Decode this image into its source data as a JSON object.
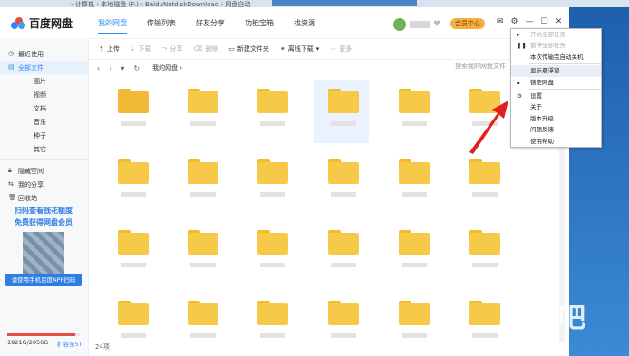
{
  "titlebar": {
    "app_name": "百度网盘",
    "tabs": [
      "我的网盘",
      "传输列表",
      "好友分享",
      "功能宝箱",
      "找资源"
    ],
    "vip_label": "会员中心"
  },
  "address": {
    "text": "› 计算机 › 本地磁盘 (F:) › BaiduNetdiskDownload › 网盘自动"
  },
  "sidebar": {
    "items": [
      {
        "label": "最近使用",
        "icon": "clock-icon"
      },
      {
        "label": "全部文件",
        "icon": "folder-icon",
        "active": true
      },
      {
        "label": "图片",
        "sub": true
      },
      {
        "label": "视频",
        "sub": true
      },
      {
        "label": "文档",
        "sub": true
      },
      {
        "label": "音乐",
        "sub": true
      },
      {
        "label": "种子",
        "sub": true
      },
      {
        "label": "其它",
        "sub": true
      },
      {
        "label": "隐藏空间",
        "icon": "lock-icon"
      },
      {
        "label": "我的分享",
        "icon": "share-icon"
      },
      {
        "label": "回收站",
        "icon": "trash-icon"
      }
    ],
    "promo_line1": "扫码查看钱花额度",
    "promo_line2": "免费获得网盘会员",
    "promo_button": "请使用手机百度APP扫码",
    "quota": "1921G/2056G",
    "quota_used_fraction": 0.934,
    "expand_label": "扩容至5T"
  },
  "toolbar": {
    "upload": "上传",
    "download": "下载",
    "share": "分享",
    "delete": "删除",
    "new_folder": "新建文件夹",
    "offline": "离线下载",
    "more": "更多"
  },
  "nav": {
    "breadcrumb": "我的网盘",
    "search_placeholder": "搜索我的网盘文件"
  },
  "status": {
    "count": "24项"
  },
  "menu": {
    "items": [
      {
        "label": "开始全部任务",
        "disabled": true,
        "icon": "play-icon"
      },
      {
        "label": "暂停全部任务",
        "disabled": true,
        "icon": "pause-icon"
      },
      {
        "label": "本次传输完自动关机",
        "disabled": false
      },
      {
        "label": "显示悬浮窗",
        "disabled": false,
        "highlight": true
      },
      {
        "label": "锁定网盘",
        "disabled": false,
        "icon": "lock-icon"
      },
      {
        "label": "设置",
        "disabled": false,
        "icon": "gear-icon"
      },
      {
        "label": "关于",
        "disabled": false
      },
      {
        "label": "版本升级",
        "disabled": false
      },
      {
        "label": "问题反馈",
        "disabled": false
      },
      {
        "label": "使用帮助",
        "disabled": false
      }
    ]
  },
  "colors": {
    "accent": "#2e8cf0",
    "folder": "#f7c948",
    "vip": "#f4b041",
    "arrow": "#e02020"
  }
}
